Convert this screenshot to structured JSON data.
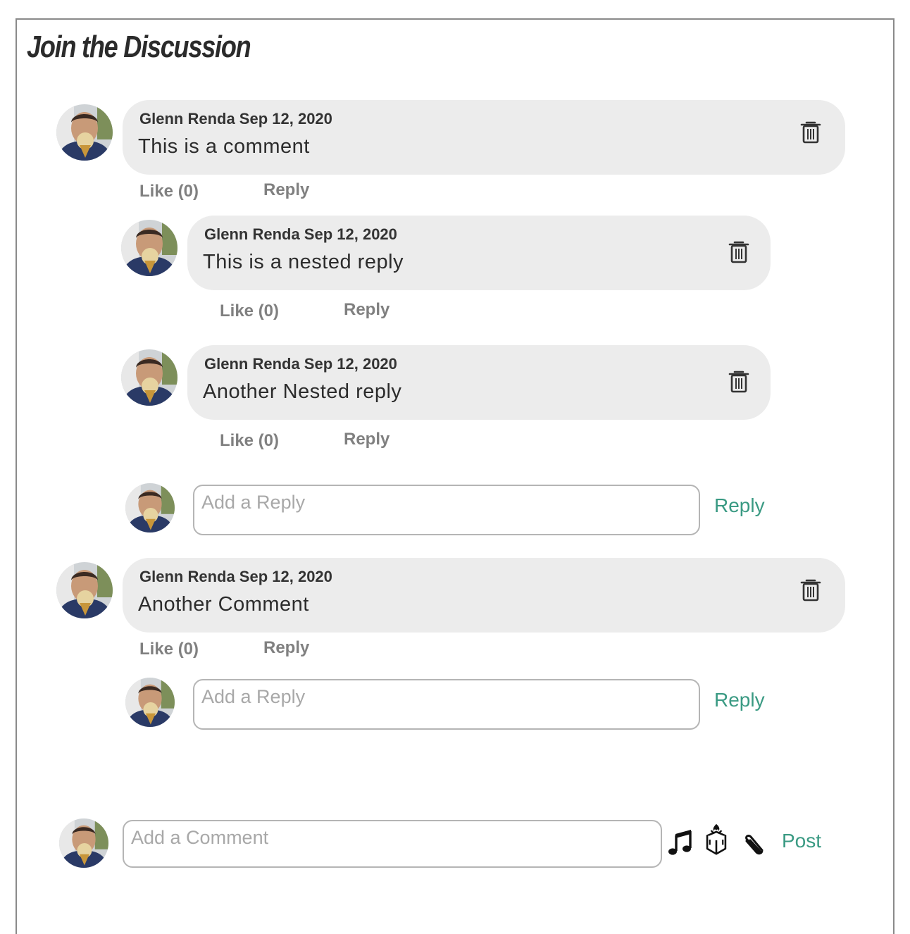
{
  "page": {
    "title": "Join the Discussion"
  },
  "colors": {
    "accent": "#3a9a83",
    "bubble": "#ececec",
    "muted": "#808080"
  },
  "comments": [
    {
      "meta": "Glenn Renda Sep 12, 2020",
      "text": "This is a comment",
      "like": "Like (0)",
      "reply": "Reply",
      "replies": [
        {
          "meta": "Glenn Renda Sep 12, 2020",
          "text": "This is a nested reply",
          "like": "Like (0)",
          "reply": "Reply"
        },
        {
          "meta": "Glenn Renda Sep 12, 2020",
          "text": "Another Nested reply",
          "like": "Like (0)",
          "reply": "Reply"
        }
      ],
      "reply_box": {
        "placeholder": "Add a Reply",
        "button": "Reply"
      }
    },
    {
      "meta": "Glenn Renda Sep 12, 2020",
      "text": "Another Comment",
      "like": "Like (0)",
      "reply": "Reply",
      "replies": [],
      "reply_box": {
        "placeholder": "Add a Reply",
        "button": "Reply"
      }
    }
  ],
  "composer": {
    "placeholder": "Add a Comment",
    "post": "Post",
    "icons": [
      "music-note-icon",
      "gift-box-icon",
      "paperclip-icon"
    ]
  }
}
